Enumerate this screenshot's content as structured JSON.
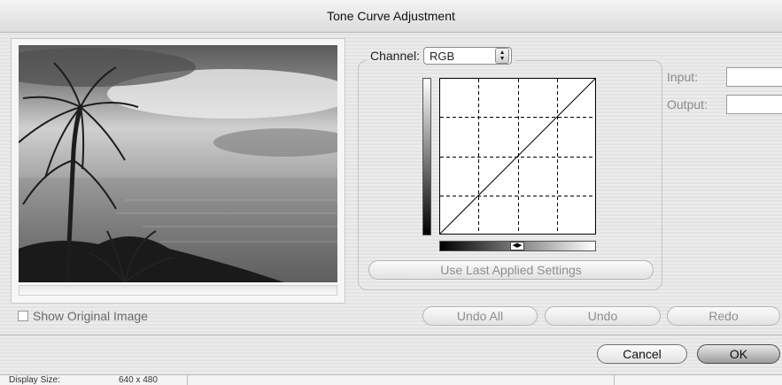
{
  "window": {
    "title": "Tone Curve Adjustment"
  },
  "preview": {
    "show_original_label": "Show Original Image",
    "show_original_checked": false
  },
  "channel": {
    "label": "Channel:",
    "selected": "RGB"
  },
  "curve": {
    "points": [
      [
        0,
        0
      ],
      [
        255,
        255
      ]
    ],
    "grid_divisions": 4,
    "midtone_slider": 0.5
  },
  "buttons": {
    "use_last": "Use Last Applied Settings",
    "undo_all": "Undo All",
    "undo": "Undo",
    "redo": "Redo",
    "cancel": "Cancel",
    "ok": "OK"
  },
  "fields": {
    "input_label": "Input:",
    "input_value": "",
    "output_label": "Output:",
    "output_value": ""
  },
  "status": {
    "display_size_label": "Display Size:",
    "display_size_value": "640 x 480"
  }
}
